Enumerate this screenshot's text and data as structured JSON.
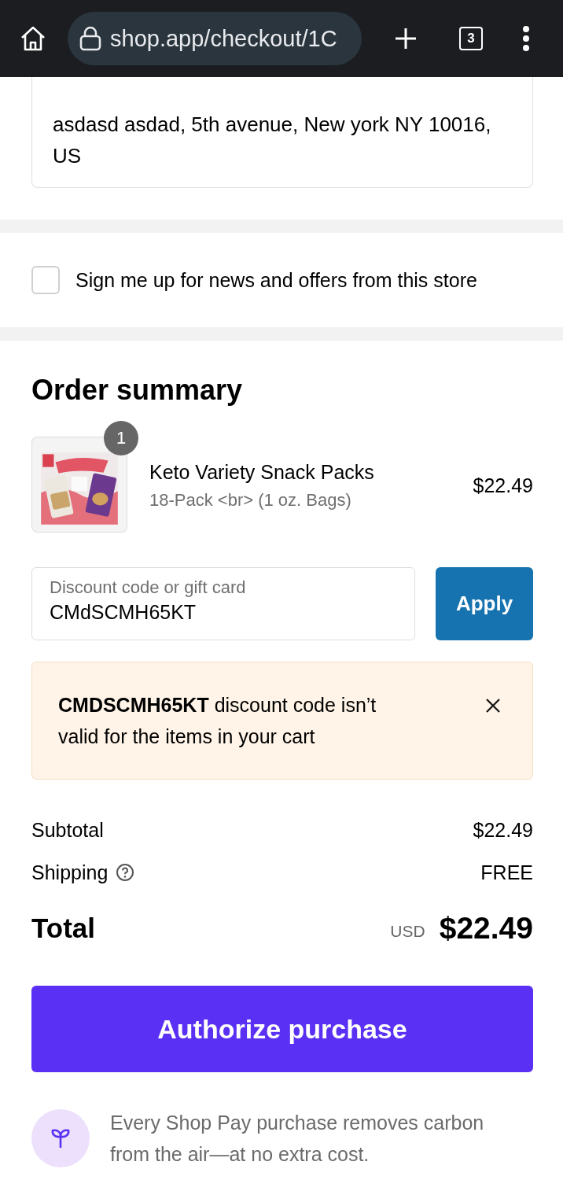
{
  "browser": {
    "url": "shop.app/checkout/1C",
    "tab_count": "3"
  },
  "bill_to": {
    "address": "asdasd asdad, 5th avenue, New york NY 10016, US"
  },
  "newsletter": {
    "label": "Sign me up for news and offers from this store",
    "checked": false
  },
  "order_summary": {
    "title": "Order summary",
    "items": [
      {
        "name": "Keto Variety Snack Packs",
        "variant": "18-Pack <br> (1 oz. Bags)",
        "price": "$22.49",
        "quantity": "1",
        "kind": "picture"
      }
    ],
    "discount": {
      "placeholder": "Discount code or gift card",
      "value": "CMdSCMH65KT",
      "button": "Apply"
    },
    "alert": {
      "message": "**CMDSCMH65KT** discount code isn’t valid for the items in your cart"
    },
    "subtotal": {
      "label": "Subtotal",
      "value": "$22.49"
    },
    "shipping": {
      "label": "Shipping",
      "value": "FREE"
    },
    "total": {
      "label": "Total",
      "currency": "USD",
      "value": "$22.49"
    }
  },
  "authorize_button": "Authorize purchase",
  "footer_note": "Every Shop Pay purchase removes carbon from the air—at no extra cost."
}
